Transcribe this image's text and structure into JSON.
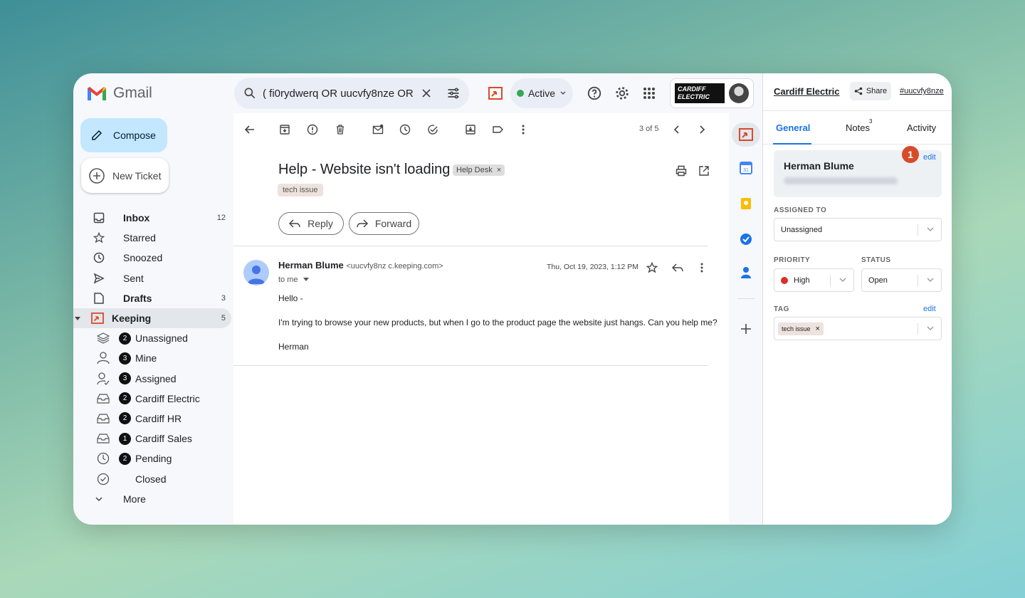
{
  "header": {
    "app_name": "Gmail",
    "search_query": "( fi0rydwerq OR  uucvfy8nze OR",
    "status_label": "Active",
    "brand_line1": "CARDIFF",
    "brand_line2": "ELECTRIC"
  },
  "sidebar": {
    "compose_label": "Compose",
    "new_ticket_label": "New Ticket",
    "items": [
      {
        "label": "Inbox",
        "count": "12"
      },
      {
        "label": "Starred",
        "count": ""
      },
      {
        "label": "Snoozed",
        "count": ""
      },
      {
        "label": "Sent",
        "count": ""
      },
      {
        "label": "Drafts",
        "count": "3"
      },
      {
        "label": "Keeping",
        "count": "5"
      }
    ],
    "keeping_items": [
      {
        "label": "Unassigned",
        "badge": "2"
      },
      {
        "label": "Mine",
        "badge": "3"
      },
      {
        "label": "Assigned",
        "badge": "3"
      },
      {
        "label": "Cardiff Electric",
        "badge": "2"
      },
      {
        "label": "Cardiff HR",
        "badge": "2"
      },
      {
        "label": "Cardiff Sales",
        "badge": "1"
      },
      {
        "label": "Pending",
        "badge": "2"
      },
      {
        "label": "Closed",
        "badge": ""
      }
    ],
    "more_label": "More"
  },
  "toolbar": {
    "pagination": "3 of 5"
  },
  "email": {
    "subject": "Help - Website isn't loading",
    "label_chip": "Help Desk",
    "tag_chip": "tech issue",
    "reply_label": "Reply",
    "forward_label": "Forward",
    "sender_name": "Herman Blume",
    "sender_email": "<uucvfy8nz   c.keeping.com>",
    "to_label": "to me",
    "date": "Thu, Oct 19, 2023, 1:12 PM",
    "body": {
      "greeting": "Hello -",
      "line1": "I'm trying to browse your new products, but when I go to the product page the website just hangs. Can you help me?",
      "signoff": "Herman"
    }
  },
  "panel": {
    "title": "Cardiff Electric",
    "share_label": "Share",
    "ticket_id": "#uucvfy8nze",
    "tabs": {
      "general": "General",
      "notes": "Notes",
      "notes_count": "3",
      "activity": "Activity"
    },
    "contact_name": "Herman Blume",
    "contact_badge": "1",
    "edit_label": "edit",
    "assigned_label": "ASSIGNED TO",
    "assigned_value": "Unassigned",
    "priority_label": "PRIORITY",
    "priority_value": "High",
    "status_label": "STATUS",
    "status_value": "Open",
    "tag_label": "TAG",
    "tag_value": "tech issue"
  },
  "colors": {
    "accent": "#1a73e8",
    "compose_bg": "#c2e7ff",
    "brand_red": "#d84b2a",
    "status_green": "#34a853"
  }
}
